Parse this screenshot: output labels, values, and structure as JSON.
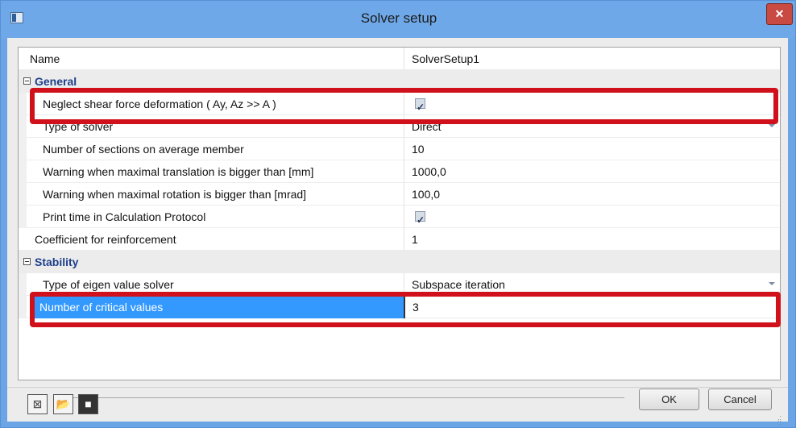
{
  "window": {
    "title": "Solver setup"
  },
  "name_row": {
    "label": "Name",
    "value": "SolverSetup1"
  },
  "general": {
    "label": "General",
    "rows": [
      {
        "label": "Neglect shear force deformation ( Ay, Az >> A )",
        "value": ""
      },
      {
        "label": "Type of solver",
        "value": "Direct"
      },
      {
        "label": "Number of sections on average member",
        "value": "10"
      },
      {
        "label": "Warning when maximal translation is bigger than [mm]",
        "value": "1000,0"
      },
      {
        "label": "Warning when maximal rotation is bigger than [mrad]",
        "value": "100,0"
      },
      {
        "label": "Print time in Calculation Protocol",
        "value": ""
      }
    ]
  },
  "coefficient_row": {
    "label": "Coefficient for reinforcement",
    "value": "1"
  },
  "stability": {
    "label": "Stability",
    "rows": [
      {
        "label": "Type of eigen value solver",
        "value": "Subspace iteration"
      },
      {
        "label": "Number of critical values",
        "value": "3"
      }
    ]
  },
  "buttons": {
    "ok": "OK",
    "cancel": "Cancel"
  },
  "colors": {
    "titlebar": "#6ea8e8",
    "highlight": "#d0101a",
    "selection": "#3399ff",
    "category": "#1c3f8a"
  }
}
